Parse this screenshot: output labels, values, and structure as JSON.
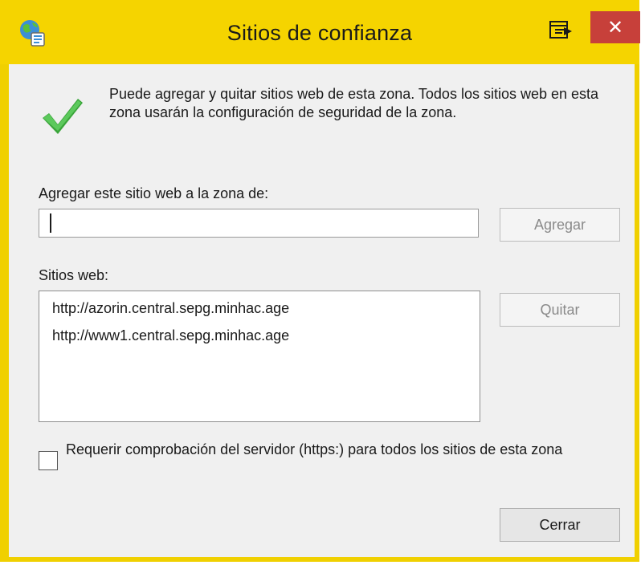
{
  "window": {
    "title": "Sitios de confianza",
    "icons": {
      "app": "globe-settings-icon",
      "restore": "restore-window-icon",
      "close": "close-icon"
    },
    "close_glyph": "✕",
    "accent_color": "#f5d400",
    "close_color": "#c7403a"
  },
  "info": {
    "icon": "green-checkmark-icon",
    "description": "Puede agregar y quitar sitios web de esta zona. Todos los sitios web en esta zona usarán la configuración de seguridad de la zona."
  },
  "add_site": {
    "label": "Agregar este sitio web a la zona de:",
    "value": "",
    "button_label": "Agregar"
  },
  "sites": {
    "label": "Sitios web:",
    "items": [
      "http://azorin.central.sepg.minhac.age",
      "http://www1.central.sepg.minhac.age"
    ],
    "remove_button_label": "Quitar"
  },
  "require_https": {
    "checked": false,
    "label": "Requerir comprobación del servidor (https:) para todos los sitios de esta zona"
  },
  "close_button_label": "Cerrar"
}
